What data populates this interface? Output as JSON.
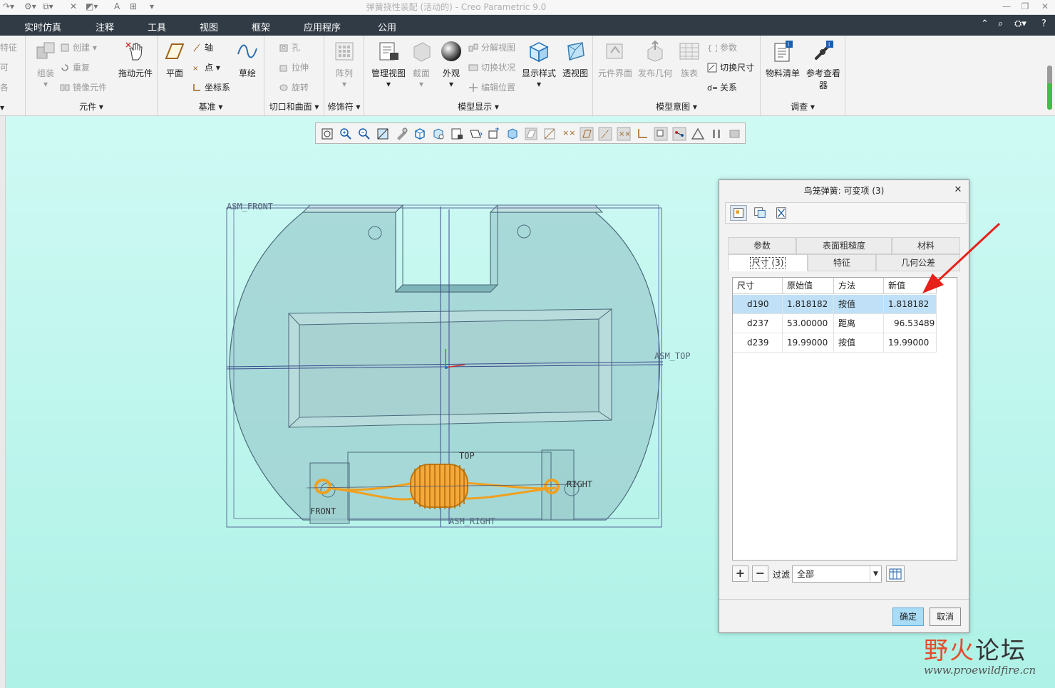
{
  "window": {
    "title": "弹簧挠性装配 (活动的) - Creo Parametric 9.0"
  },
  "ribbon_tabs": [
    "实时仿真",
    "注释",
    "工具",
    "视图",
    "框架",
    "应用程序",
    "公用"
  ],
  "ribbon": {
    "left_cut": {
      "i1": "特征",
      "i2": "可",
      "i3": "各"
    },
    "component": {
      "label": "元件",
      "assemble": "组装",
      "create": "创建",
      "repeat": "重复",
      "mirror": "镜像元件",
      "drag": "拖动元件"
    },
    "datum": {
      "label": "基准",
      "plane": "平面",
      "axis": "轴",
      "point": "点",
      "csys": "坐标系",
      "sketch": "草绘"
    },
    "cut_surface": {
      "label": "切口和曲面",
      "hole": "孔",
      "extrude": "拉伸",
      "revolve": "旋转"
    },
    "modifiers": {
      "label": "修饰符",
      "pattern": "阵列"
    },
    "model_display": {
      "label": "模型显示",
      "manage_views": "管理视图",
      "section": "截面",
      "appearance": "外观",
      "explode_view": "分解视图",
      "toggle_status": "切换状况",
      "edit_position": "编辑位置",
      "display_style": "显示样式",
      "perspective": "透视图"
    },
    "model_intent": {
      "label": "模型意图",
      "component_interface": "元件界面",
      "publish_geometry": "发布几何",
      "family_table": "族表",
      "parameters": "参数",
      "switch_dimensions": "切换尺寸",
      "relations": "关系"
    },
    "investigate": {
      "label": "调查",
      "bom": "物料清单",
      "reference_viewer": "参考查看器"
    }
  },
  "model_labels": {
    "asm_front": "ASM_FRONT",
    "asm_top": "ASM_TOP",
    "asm_right": "ASM_RIGHT",
    "top": "TOP",
    "front": "FRONT",
    "right": "RIGHT"
  },
  "dialog": {
    "title": "鸟笼弹簧: 可变项 (3)",
    "tabs_row1": [
      "参数",
      "表面粗糙度",
      "材料"
    ],
    "tabs_row2": [
      "尺寸 (3)",
      "特征",
      "几何公差"
    ],
    "columns": [
      "尺寸",
      "原始值",
      "方法",
      "新值"
    ],
    "rows": [
      {
        "dim": "d190",
        "original": "1.818182",
        "method": "按值",
        "new": "1.818182",
        "selected": true
      },
      {
        "dim": "d237",
        "original": "53.00000",
        "method": "距离",
        "new": "96.53489",
        "selected": false
      },
      {
        "dim": "d239",
        "original": "19.99000",
        "method": "按值",
        "new": "19.99000",
        "selected": false
      }
    ],
    "filter_label": "过滤",
    "filter_value": "全部",
    "ok": "确定",
    "cancel": "取消"
  },
  "watermark": {
    "cn_a": "野火",
    "cn_b": "论坛",
    "url": "www.proewildfire.cn"
  },
  "colors": {
    "tabbar": "#313b45",
    "graphics_bg": "#bff7ee",
    "spring": "#f0a020",
    "selected_row": "#bfe0f7",
    "arrow": "#e8201a"
  }
}
